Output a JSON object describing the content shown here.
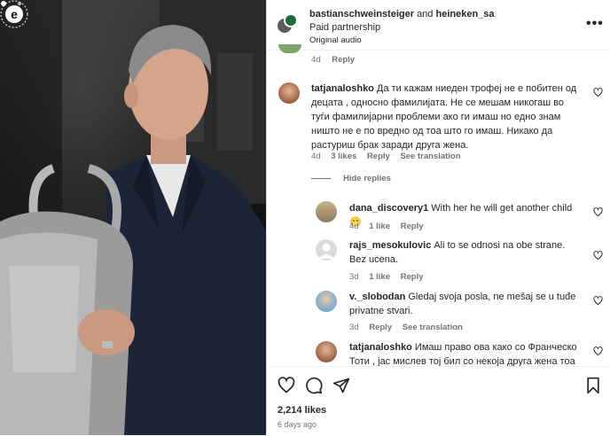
{
  "header": {
    "user1": "bastianschweinsteiger",
    "and_text": "and",
    "user2": "heineken_sa",
    "subtitle": "Paid partnership",
    "audio": "Original audio",
    "more_icon": "more-horizontal-icon"
  },
  "partial_comment": {
    "time": "4d",
    "reply": "Reply"
  },
  "comments": [
    {
      "user": "tatjanaloshko",
      "text": "Да ти кажам ниеден трофеј не е побитен од децата , односно фамилијата. Не се мешам никогаш во туѓи фамилијарни проблеми ако ги имаш но едно знам ништо не е по вредно од тоа што го имаш. Никако да растуриш брак заради друга жена.",
      "time": "4d",
      "likes": "3 likes",
      "reply": "Reply",
      "translate": "See translation"
    }
  ],
  "hide_replies": "Hide replies",
  "replies": [
    {
      "user": "dana_discovery1",
      "text": "With her he will get another child 😁",
      "time": "4d",
      "likes": "1 like",
      "reply": "Reply"
    },
    {
      "user": "rajs_mesokulovic",
      "text": "Ali to se odnosi na obe strane. Bez ucena.",
      "time": "3d",
      "likes": "1 like",
      "reply": "Reply"
    },
    {
      "user": "v._slobodan",
      "text": "Gledaj svoja posla, ne mešaj se u tuđe privatne stvari.",
      "time": "3d",
      "reply": "Reply",
      "translate": "See translation"
    },
    {
      "user": "tatjanaloshko",
      "text": "Имаш право ова како со Франческо Тоти , јас мислев тој бил со некоја друга жена тоа"
    }
  ],
  "actions": {
    "like_icon": "heart-icon",
    "comment_icon": "comment-icon",
    "share_icon": "send-icon",
    "save_icon": "bookmark-icon",
    "likes": "2,214 likes",
    "time_ago": "6 days ago"
  },
  "media": {
    "watermark": "e",
    "watermark_ring": "EPISODE PRODUCTIONS"
  }
}
